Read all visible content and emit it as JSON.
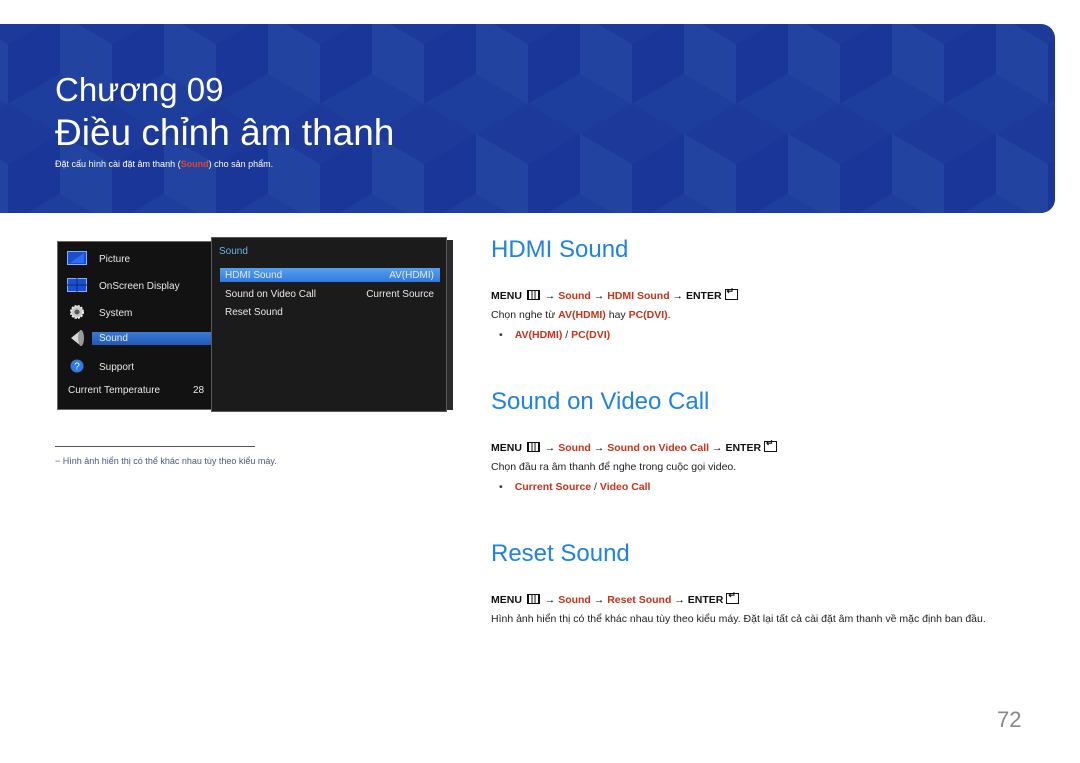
{
  "banner": {
    "chapter": "Chương 09",
    "title": "Điều chỉnh âm thanh",
    "subtitle_pre": "Đặt cấu hình cài đặt âm thanh (",
    "subtitle_hl": "Sound",
    "subtitle_post": ") cho sản phẩm.",
    "color": "#1d3a9a"
  },
  "osd": {
    "left_menu": [
      {
        "label": "Picture",
        "icon": "picture-icon",
        "selected": false
      },
      {
        "label": "OnScreen Display",
        "icon": "onscreen-display-icon",
        "selected": false
      },
      {
        "label": "System",
        "icon": "gear-icon",
        "selected": false
      },
      {
        "label": "Sound",
        "icon": "speaker-icon",
        "selected": true
      },
      {
        "label": "Support",
        "icon": "question-icon",
        "selected": false
      }
    ],
    "temperature_label": "Current Temperature",
    "temperature_value": "28",
    "submenu_title": "Sound",
    "submenu": [
      {
        "label": "HDMI Sound",
        "value": "AV(HDMI)",
        "selected": true
      },
      {
        "label": "Sound on Video Call",
        "value": "Current Source",
        "selected": false
      },
      {
        "label": "Reset Sound",
        "value": "",
        "selected": false
      }
    ]
  },
  "footnote": "−  Hình ảnh hiển thị có thể khác nhau tùy theo kiểu máy.",
  "sections": [
    {
      "heading": "HDMI Sound",
      "path": {
        "menu": "MENU",
        "arrow": "→",
        "p1": "Sound",
        "p2": "HDMI Sound",
        "enter": "ENTER"
      },
      "desc_pre": "Chọn nghe từ ",
      "desc_hl1": "AV(HDMI)",
      "desc_mid": " hay ",
      "desc_hl2": "PC(DVI)",
      "desc_post": ".",
      "options": {
        "bullet": "•",
        "a": "AV(HDMI)",
        "slash": " / ",
        "b": "PC(DVI)"
      }
    },
    {
      "heading": "Sound on Video Call",
      "path": {
        "menu": "MENU",
        "arrow": "→",
        "p1": "Sound",
        "p2": "Sound on Video Call",
        "enter": "ENTER"
      },
      "desc": "Chọn đầu ra âm thanh để nghe trong cuộc gọi video.",
      "options": {
        "bullet": "•",
        "a": "Current Source",
        "slash": " / ",
        "b": "Video Call"
      }
    },
    {
      "heading": "Reset Sound",
      "path": {
        "menu": "MENU",
        "arrow": "→",
        "p1": "Sound",
        "p2": "Reset Sound",
        "enter": "ENTER"
      },
      "desc": "Hình ảnh hiển thị có thể khác nhau tùy theo kiểu máy. Đặt lại tất cả cài đặt âm thanh về mặc định ban đầu."
    }
  ],
  "page_number": "72",
  "colors": {
    "heading_blue": "#1e82e6",
    "highlight_red": "#c8331a",
    "osd_select": "#2f7be0"
  }
}
